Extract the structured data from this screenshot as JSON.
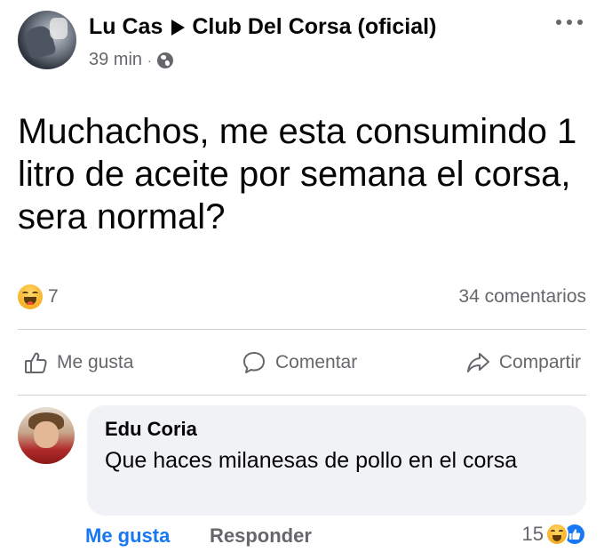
{
  "post": {
    "author": "Lu Cas",
    "group": "Club Del Corsa (oficial)",
    "time": "39 min",
    "separator": "·",
    "text": "Muchachos, me esta consumindo 1 litro de aceite por semana el corsa, sera normal?",
    "privacy_icon": "globe-icon",
    "menu_icon": "more-options-icon"
  },
  "stats": {
    "reaction_type": "haha",
    "reaction_count": "7",
    "comments": "34 comentarios"
  },
  "actions": {
    "like_label": "Me gusta",
    "comment_label": "Comentar",
    "share_label": "Compartir"
  },
  "comment": {
    "author": "Edu Coria",
    "text": "Que haces milanesas de pollo en el corsa",
    "like_label": "Me gusta",
    "reply_label": "Responder",
    "reaction_count": "15",
    "reactions": [
      "haha",
      "like"
    ]
  },
  "colors": {
    "accent": "#1877f2",
    "secondary_text": "#65676b",
    "bubble_bg": "#f0f2f5",
    "divider": "#ced0d4"
  }
}
